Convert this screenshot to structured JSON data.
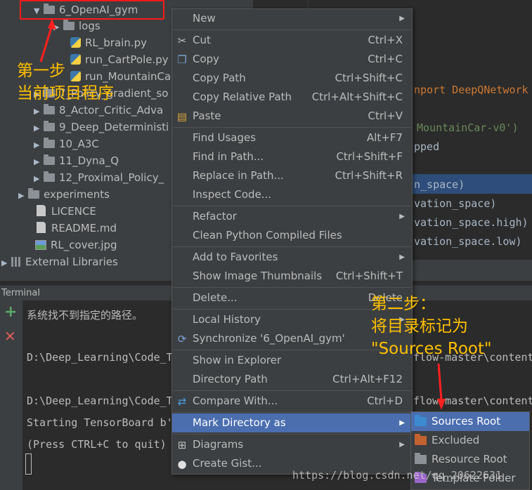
{
  "project_tree": {
    "items": [
      {
        "label": "6_OpenAI_gym",
        "type": "folder",
        "expanded": true
      },
      {
        "label": "logs",
        "type": "folder"
      },
      {
        "label": "RL_brain.py",
        "type": "py"
      },
      {
        "label": "run_CartPole.py",
        "type": "py"
      },
      {
        "label": "run_MountainCar",
        "type": "py"
      },
      {
        "label": "7_Policy_gradient_so",
        "type": "folder"
      },
      {
        "label": "8_Actor_Critic_Adva",
        "type": "folder"
      },
      {
        "label": "9_Deep_Deterministi",
        "type": "folder"
      },
      {
        "label": "10_A3C",
        "type": "folder"
      },
      {
        "label": "11_Dyna_Q",
        "type": "folder"
      },
      {
        "label": "12_Proximal_Policy_",
        "type": "folder"
      },
      {
        "label": "experiments",
        "type": "folder"
      },
      {
        "label": "LICENCE",
        "type": "doc"
      },
      {
        "label": "README.md",
        "type": "doc"
      },
      {
        "label": "RL_cover.jpg",
        "type": "img"
      },
      {
        "label": "External Libraries",
        "type": "lib"
      }
    ]
  },
  "editor": {
    "lines": [
      "nport DeepQNetwork",
      "MountainCar-v0')",
      "pped",
      "n_space)",
      "vation_space)",
      "vation_space.high)",
      "vation_space.low)"
    ]
  },
  "terminal": {
    "title": "Terminal",
    "lines": [
      "系统找不到指定的路径。",
      "D:\\Deep_Learning\\Code_T",
      "D:\\Deep_Learning\\Code_T",
      "Starting TensorBoard b'",
      "(Press CTRL+C to quit)"
    ],
    "right_fragments": [
      "flow-master\\content",
      "flow-master\\content"
    ]
  },
  "context_menu": {
    "items": [
      {
        "label": "New",
        "shortcut": "",
        "submenu": true
      },
      {
        "label": "Cut",
        "shortcut": "Ctrl+X",
        "icon": "scissors-icon"
      },
      {
        "label": "Copy",
        "shortcut": "Ctrl+C",
        "icon": "copy-icon"
      },
      {
        "label": "Copy Path",
        "shortcut": "Ctrl+Shift+C"
      },
      {
        "label": "Copy Relative Path",
        "shortcut": "Ctrl+Alt+Shift+C"
      },
      {
        "label": "Paste",
        "shortcut": "Ctrl+V",
        "icon": "paste-icon"
      },
      {
        "label": "Find Usages",
        "shortcut": "Alt+F7"
      },
      {
        "label": "Find in Path...",
        "shortcut": "Ctrl+Shift+F"
      },
      {
        "label": "Replace in Path...",
        "shortcut": "Ctrl+Shift+R"
      },
      {
        "label": "Inspect Code...",
        "shortcut": ""
      },
      {
        "label": "Refactor",
        "shortcut": "",
        "submenu": true
      },
      {
        "label": "Clean Python Compiled Files",
        "shortcut": ""
      },
      {
        "label": "Add to Favorites",
        "shortcut": "",
        "submenu": true
      },
      {
        "label": "Show Image Thumbnails",
        "shortcut": "Ctrl+Shift+T"
      },
      {
        "label": "Delete...",
        "shortcut": "Delete"
      },
      {
        "label": "Local History",
        "shortcut": "",
        "submenu": true
      },
      {
        "label": "Synchronize '6_OpenAI_gym'",
        "shortcut": "",
        "icon": "sync-icon"
      },
      {
        "label": "Show in Explorer",
        "shortcut": ""
      },
      {
        "label": "Directory Path",
        "shortcut": "Ctrl+Alt+F12"
      },
      {
        "label": "Compare With...",
        "shortcut": "Ctrl+D",
        "icon": "compare-icon"
      },
      {
        "label": "Mark Directory as",
        "shortcut": "",
        "submenu": true,
        "active": true
      },
      {
        "label": "Diagrams",
        "shortcut": "",
        "submenu": true,
        "icon": "diagram-icon"
      },
      {
        "label": "Create Gist...",
        "shortcut": "",
        "icon": "github-icon"
      }
    ]
  },
  "mark_submenu": {
    "items": [
      {
        "label": "Sources Root",
        "color": "#3d8ad1",
        "active": true
      },
      {
        "label": "Excluded",
        "color": "#c26230"
      },
      {
        "label": "Resource Root",
        "color": "#8c9097"
      },
      {
        "label": "Template Folder",
        "color": "#9a66c9"
      }
    ]
  },
  "annotations": {
    "step1_line1": "第一步",
    "step1_line2": "当前项目程序",
    "step2_line1": "第二步：",
    "step2_line2": "将目录标记为",
    "step2_line3": "\"Sources Root\""
  },
  "watermark": "https://blog.csdn.net/qq_20622631",
  "colors": {
    "annotation": "#ffc000",
    "highlight_box": "#ff1a1a",
    "menu_active": "#4b6eaf"
  }
}
